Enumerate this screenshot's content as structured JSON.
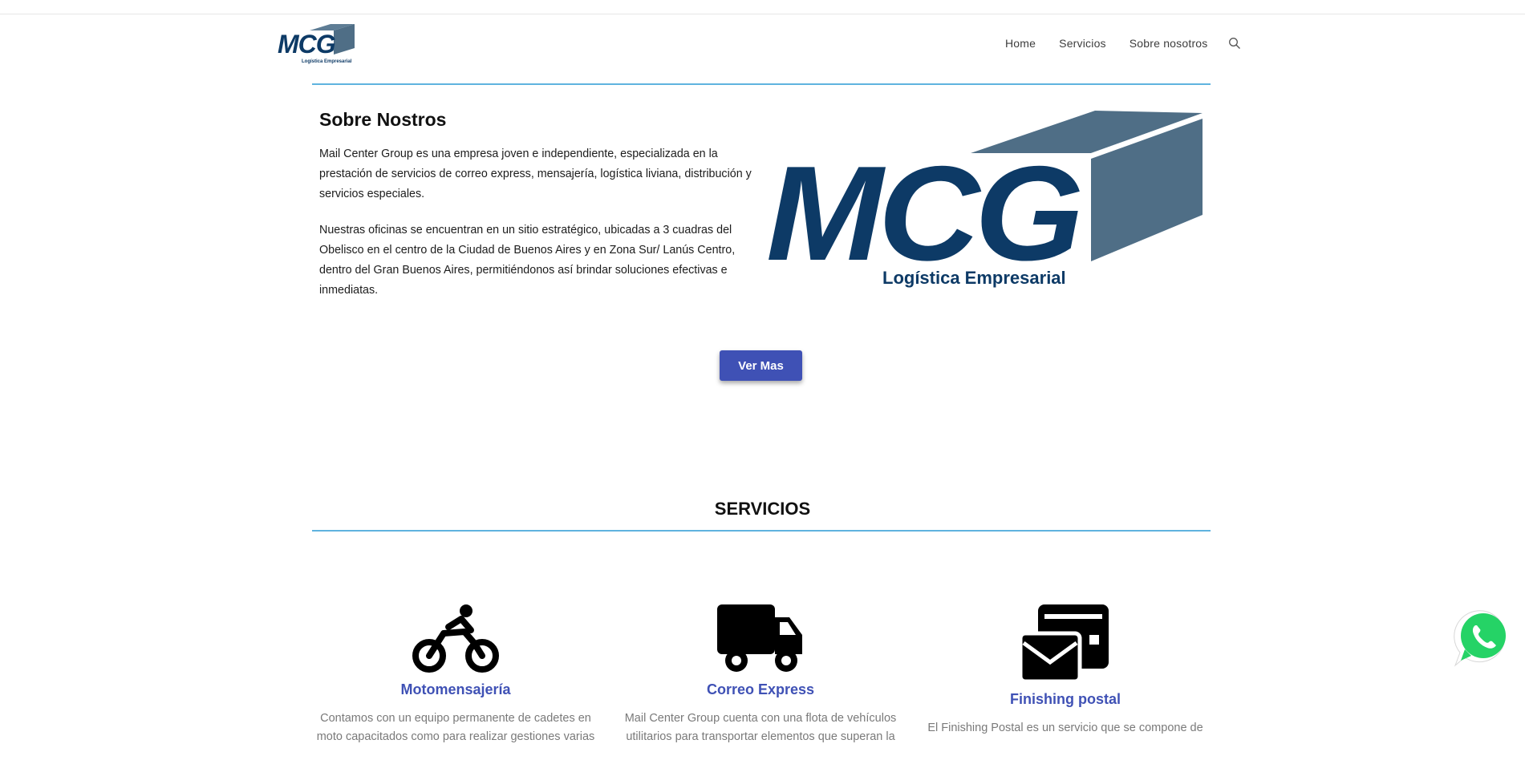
{
  "header": {
    "logo": {
      "text": "MCG",
      "tagline": "Logística Empresarial"
    },
    "nav": [
      "Home",
      "Servicios",
      "Sobre nosotros"
    ]
  },
  "about": {
    "title": "Sobre Nostros",
    "paragraphs": [
      "Mail Center Group es una empresa joven e independiente, especializada en la prestación de servicios de correo express, mensajería, logística liviana, distribución y servicios especiales.",
      "Nuestras oficinas se encuentran en un sitio estratégico, ubicadas a 3 cuadras del Obelisco en el centro de la Ciudad de Buenos Aires y en Zona Sur/ Lanús Centro, dentro del Gran Buenos Aires, permitiéndonos así brindar soluciones efectivas e inmediatas."
    ],
    "logo": {
      "text": "MCG",
      "tagline": "Logística Empresarial"
    },
    "button_label": "Ver Mas"
  },
  "services": {
    "title": "SERVICIOS",
    "items": [
      {
        "icon": "motorcycle-icon",
        "title": "Motomensajería",
        "text": "Contamos con un equipo permanente de cadetes en moto capacitados como para realizar gestiones varias"
      },
      {
        "icon": "truck-icon",
        "title": "Correo Express",
        "text": "Mail Center Group cuenta con una flota de vehículos utilitarios para transportar elementos que superan la"
      },
      {
        "icon": "envelopes-icon",
        "title": "Finishing postal",
        "text": "El Finishing Postal es un servicio que se compone de"
      }
    ]
  },
  "colors": {
    "accent": "#3f51b5",
    "rule": "#5fb3df",
    "logo_dark": "#0d3a66",
    "logo_box": "#4f6e86",
    "whatsapp": "#25d366"
  }
}
